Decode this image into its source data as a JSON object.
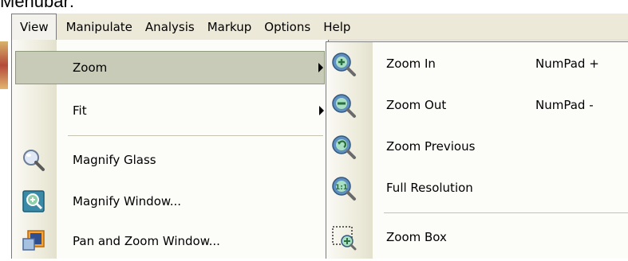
{
  "title_crop": "Menubar:",
  "menubar": {
    "items": [
      {
        "label": "View",
        "open": true
      },
      {
        "label": "Manipulate"
      },
      {
        "label": "Analysis"
      },
      {
        "label": "Markup"
      },
      {
        "label": "Options"
      },
      {
        "label": "Help"
      }
    ]
  },
  "view_menu": {
    "items": [
      {
        "label": "Zoom",
        "icon": "none",
        "submenu": true,
        "highlighted": true
      },
      {
        "label": "Fit",
        "icon": "none",
        "submenu": true
      },
      {
        "label": "Magnify Glass",
        "icon": "magnifying-glass-icon"
      },
      {
        "label": "Magnify Window...",
        "icon": "magnify-window-icon"
      },
      {
        "label": "Pan and Zoom Window...",
        "icon": "pan-zoom-window-icon"
      }
    ]
  },
  "zoom_submenu": {
    "items": [
      {
        "label": "Zoom In",
        "shortcut": "NumPad +",
        "icon": "zoom-in-icon"
      },
      {
        "label": "Zoom Out",
        "shortcut": "NumPad -",
        "icon": "zoom-out-icon"
      },
      {
        "label": "Zoom Previous",
        "icon": "zoom-previous-icon"
      },
      {
        "label": "Full Resolution",
        "icon": "full-resolution-icon"
      },
      {
        "label": "Zoom Box",
        "icon": "zoom-box-icon"
      }
    ]
  }
}
